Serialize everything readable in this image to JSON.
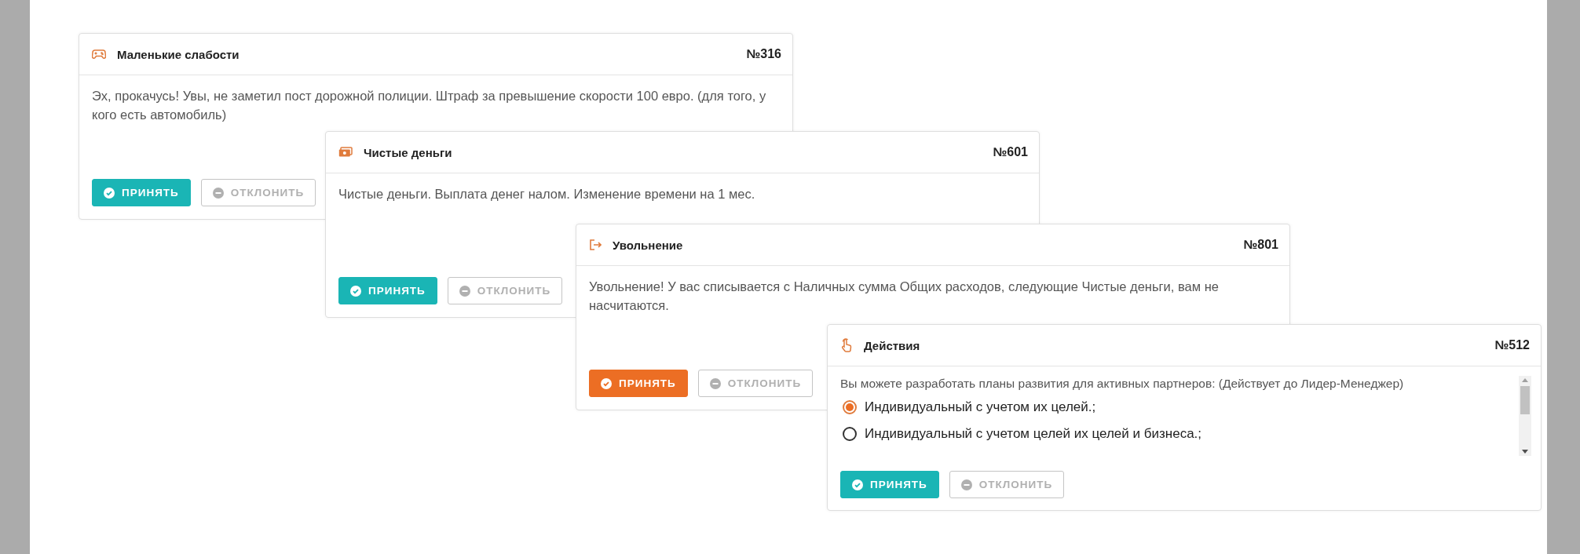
{
  "cards": [
    {
      "title": "Маленькие слабости",
      "number": "№316",
      "text": "Эх, прокачусь! Увы, не заметил пост дорожной полиции. Штраф за превышение скорости 100 евро. (для того, у кого есть автомобиль)",
      "accept": {
        "label": "ПРИНЯТЬ",
        "hovered": false
      },
      "reject": {
        "label": "ОТКЛОНИТЬ",
        "disabled": true
      }
    },
    {
      "title": "Чистые деньги",
      "number": "№601",
      "text": "Чистые деньги. Выплата денег налом. Изменение времени на 1 мес.",
      "accept": {
        "label": "ПРИНЯТЬ",
        "hovered": false
      },
      "reject": {
        "label": "ОТКЛОНИТЬ",
        "disabled": true
      }
    },
    {
      "title": "Увольнение",
      "number": "№801",
      "text": "Увольнение! У вас списывается с Наличных сумма Общих расходов, следующие Чистые деньги, вам не насчитаются.",
      "accept": {
        "label": "ПРИНЯТЬ",
        "hovered": true
      },
      "reject": {
        "label": "ОТКЛОНИТЬ",
        "disabled": true
      }
    },
    {
      "title": "Действия",
      "number": "№512",
      "text": "Вы можете разработать планы развития для активных партнеров: (Действует до Лидер-Менеджер)",
      "options": [
        {
          "label": "Индивидуальный с учетом их целей.;",
          "selected": true
        },
        {
          "label": "Индивидуальный с учетом целей их целей и бизнеса.;",
          "selected": false
        }
      ],
      "accept": {
        "label": "ПРИНЯТЬ",
        "hovered": false
      },
      "reject": {
        "label": "ОТКЛОНИТЬ",
        "disabled": true
      }
    }
  ]
}
